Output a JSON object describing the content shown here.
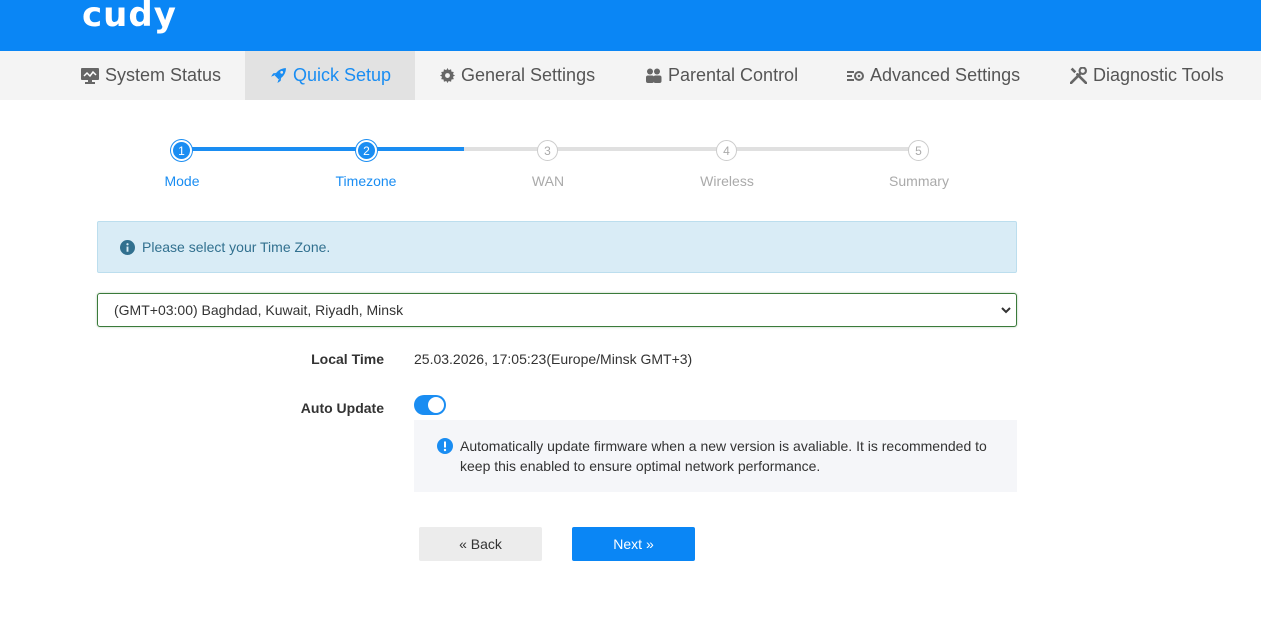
{
  "brand": {
    "logo_text": "cudy",
    "color": "#0a86f5"
  },
  "nav": {
    "items": [
      {
        "label": "System Status",
        "icon": "monitor-icon"
      },
      {
        "label": "Quick Setup",
        "icon": "rocket-icon",
        "active": true
      },
      {
        "label": "General Settings",
        "icon": "gear-icon"
      },
      {
        "label": "Parental Control",
        "icon": "users-icon"
      },
      {
        "label": "Advanced Settings",
        "icon": "sliders-icon"
      },
      {
        "label": "Diagnostic Tools",
        "icon": "wrench-icon"
      }
    ]
  },
  "stepper": {
    "current_step": 2,
    "steps": [
      {
        "number": "1",
        "label": "Mode"
      },
      {
        "number": "2",
        "label": "Timezone"
      },
      {
        "number": "3",
        "label": "WAN"
      },
      {
        "number": "4",
        "label": "Wireless"
      },
      {
        "number": "5",
        "label": "Summary"
      }
    ]
  },
  "info": {
    "text": "Please select your Time Zone.",
    "icon": "info-circle-icon"
  },
  "timezone": {
    "selected": "(GMT+03:00) Baghdad, Kuwait, Riyadh, Minsk"
  },
  "local_time": {
    "label": "Local Time",
    "value": "25.03.2026, 17:05:23(Europe/Minsk GMT+3)"
  },
  "auto_update": {
    "label": "Auto Update",
    "enabled": true,
    "note": "Automatically update firmware when a new version is avaliable. It is recommended to keep this enabled to ensure optimal network performance.",
    "note_icon": "exclamation-circle-icon"
  },
  "buttons": {
    "back_label": "« Back",
    "next_label": "Next »"
  }
}
